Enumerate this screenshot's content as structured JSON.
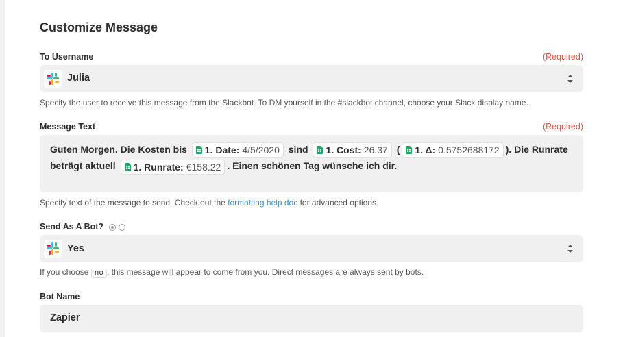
{
  "title": "Customize Message",
  "to_username": {
    "label": "To Username",
    "required": "(Required)",
    "value": "Julia",
    "help": "Specify the user to receive this message from the Slackbot. To DM yourself in the #slackbot channel, choose your Slack display name."
  },
  "message_text": {
    "label": "Message Text",
    "required": "(Required)",
    "seg1": "Guten Morgen. Die Kosten bis",
    "pill_date_label": "1. Date:",
    "pill_date_value": "4/5/2020",
    "seg2": "sind",
    "pill_cost_label": "1. Cost:",
    "pill_cost_value": "26.37",
    "paren_open": "(",
    "pill_delta_label": "1. Δ:",
    "pill_delta_value": "0.5752688172",
    "seg3": "). Die Runrate",
    "seg4": "beträgt aktuell",
    "pill_runrate_label": "1. Runrate:",
    "pill_runrate_value": "€158.22",
    "seg5": ". Einen schönen Tag wünsche ich dir.",
    "help_before": "Specify text of the message to send. Check out the",
    "help_link": "formatting help doc",
    "help_after": "for advanced options."
  },
  "send_as_bot": {
    "label": "Send As A Bot?",
    "value": "Yes",
    "help_before": "If you choose",
    "help_code": "no",
    "help_after": ", this message will appear to come from you. Direct messages are always sent by bots."
  },
  "bot_name": {
    "label": "Bot Name",
    "value": "Zapier"
  },
  "icons": {
    "slack": "slack-logo-icon",
    "sheets": "google-sheets-icon",
    "select": "select-arrows-icon"
  },
  "colors": {
    "required": "#e2583e",
    "link": "#3d8fd8",
    "sheets_green": "#21a464",
    "field_bg": "#f0f0f0"
  }
}
